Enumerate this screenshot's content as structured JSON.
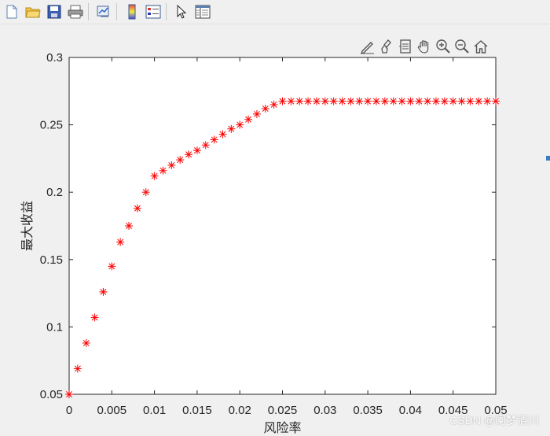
{
  "toolbar": {
    "icons": [
      "new-figure-icon",
      "open-file-icon",
      "save-icon",
      "print-icon",
      "link-plot-icon",
      "colorbar-icon",
      "legend-icon",
      "select-arrow-icon",
      "property-editor-icon"
    ]
  },
  "axes_toolbar": {
    "icons": [
      "edit-plot-icon",
      "brush-icon",
      "data-tips-icon",
      "pan-hand-icon",
      "zoom-in-icon",
      "zoom-out-icon",
      "home-icon"
    ]
  },
  "watermark": "CSDN @阑梦清川",
  "chart_data": {
    "type": "scatter",
    "xlabel": "风险率",
    "ylabel": "最大收益",
    "xlim": [
      0,
      0.05
    ],
    "ylim": [
      0.05,
      0.3
    ],
    "xticks": [
      "0",
      "0.005",
      "0.01",
      "0.015",
      "0.02",
      "0.025",
      "0.03",
      "0.035",
      "0.04",
      "0.045",
      "0.05"
    ],
    "yticks": [
      "0.05",
      "0.1",
      "0.15",
      "0.2",
      "0.25",
      "0.3"
    ],
    "marker": "*",
    "marker_color": "#ff0000",
    "grid": false,
    "series": [
      {
        "x": [
          0,
          0.001,
          0.002,
          0.003,
          0.004,
          0.005,
          0.006,
          0.007,
          0.008,
          0.009,
          0.01,
          0.011,
          0.012,
          0.013,
          0.014,
          0.015,
          0.016,
          0.017,
          0.018,
          0.019,
          0.02,
          0.021,
          0.022,
          0.023,
          0.024,
          0.025,
          0.026,
          0.027,
          0.028,
          0.029,
          0.03,
          0.031,
          0.032,
          0.033,
          0.034,
          0.035,
          0.036,
          0.037,
          0.038,
          0.039,
          0.04,
          0.041,
          0.042,
          0.043,
          0.044,
          0.045,
          0.046,
          0.047,
          0.048,
          0.049,
          0.05
        ],
        "y": [
          0.05,
          0.069,
          0.088,
          0.107,
          0.126,
          0.145,
          0.163,
          0.175,
          0.188,
          0.2,
          0.212,
          0.216,
          0.22,
          0.224,
          0.228,
          0.231,
          0.235,
          0.239,
          0.243,
          0.247,
          0.25,
          0.254,
          0.258,
          0.262,
          0.265,
          0.2675,
          0.2675,
          0.2675,
          0.2675,
          0.2675,
          0.2675,
          0.2675,
          0.2675,
          0.2675,
          0.2675,
          0.2675,
          0.2675,
          0.2675,
          0.2675,
          0.2675,
          0.2675,
          0.2675,
          0.2675,
          0.2675,
          0.2675,
          0.2675,
          0.2675,
          0.2675,
          0.2675,
          0.2675,
          0.2675
        ]
      }
    ]
  }
}
